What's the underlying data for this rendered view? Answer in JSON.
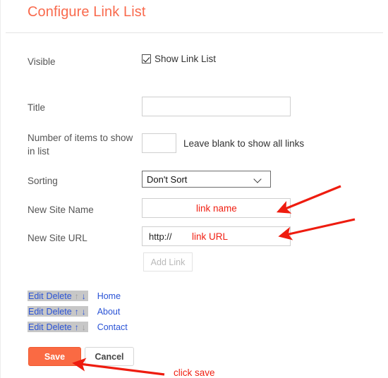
{
  "dialog": {
    "title": "Configure Link List"
  },
  "form": {
    "visible": {
      "label": "Visible",
      "checkbox_label": "Show Link List",
      "checked": true
    },
    "title_field": {
      "label": "Title",
      "value": "",
      "placeholder": ""
    },
    "count_field": {
      "label": "Number of items to show in list",
      "value": "",
      "placeholder": "",
      "hint": "Leave blank to show all links"
    },
    "sorting": {
      "label": "Sorting",
      "selected": "Don't Sort"
    },
    "new_site_name": {
      "label": "New Site Name",
      "value": "",
      "placeholder": ""
    },
    "new_site_url": {
      "label": "New Site URL",
      "prefix": "http://",
      "value": "",
      "placeholder": ""
    },
    "add_link_button": "Add Link"
  },
  "links": {
    "rows": [
      {
        "edit": "Edit",
        "delete": "Delete",
        "up": "↑",
        "down": "↓",
        "up_enabled": false,
        "down_enabled": true,
        "name": "Home"
      },
      {
        "edit": "Edit",
        "delete": "Delete",
        "up": "↑",
        "down": "↓",
        "up_enabled": true,
        "down_enabled": true,
        "name": "About"
      },
      {
        "edit": "Edit",
        "delete": "Delete",
        "up": "↑",
        "down": "↓",
        "up_enabled": true,
        "down_enabled": false,
        "name": "Contact"
      }
    ]
  },
  "footer": {
    "save_label": "Save",
    "cancel_label": "Cancel"
  },
  "annotations": {
    "link_name": "link name",
    "link_url": "link URL",
    "click_save": "click save",
    "color": "#f01f12"
  },
  "colors": {
    "title": "#f96a4d",
    "save_button": "#fa6a43",
    "link_blue": "#2a53d6",
    "row_highlight": "#c7c7c7"
  }
}
